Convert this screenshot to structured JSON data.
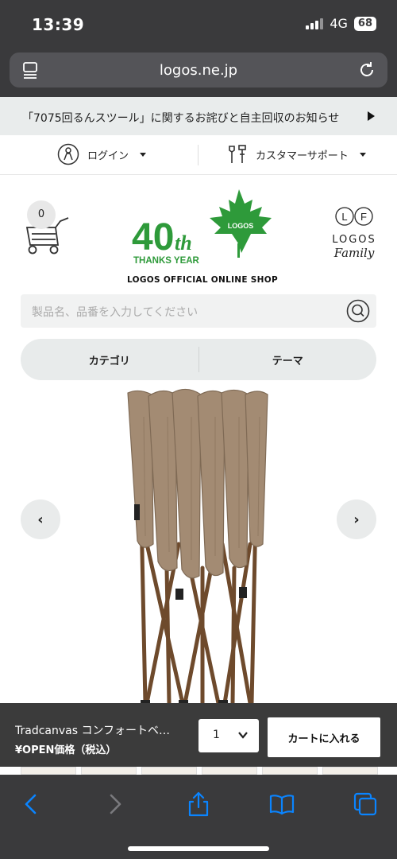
{
  "status_bar": {
    "time": "13:39",
    "network": "4G",
    "battery": "68"
  },
  "browser": {
    "url": "logos.ne.jp"
  },
  "announcement": {
    "text": "「7075回るんスツール」に関するお詫びと自主回収のお知らせ"
  },
  "utility": {
    "login_label": "ログイン",
    "support_label": "カスタマーサポート"
  },
  "header": {
    "cart_count": "0",
    "logo_40": "40",
    "logo_th": "th",
    "logo_thanks": "THANKS YEAR",
    "logo_leaf_text": "LOGOS",
    "logo_tagline": "LOGOS OFFICIAL ONLINE SHOP",
    "family_circles": [
      "L",
      "F"
    ],
    "family_top": "LOGOS",
    "family_bottom": "Family"
  },
  "search": {
    "placeholder": "製品名、品番を入力してください"
  },
  "nav": {
    "category_label": "カテゴリ",
    "theme_label": "テーマ"
  },
  "carousel": {
    "prev_label": "‹",
    "next_label": "›"
  },
  "purchase_bar": {
    "product_name": "Tradcanvas コンフォートベ…",
    "price_label": "¥OPEN価格（税込）",
    "quantity": "1",
    "add_to_cart_label": "カートに入れる"
  },
  "colors": {
    "brand_green": "#2e9a3a",
    "chrome_dark": "#3a3a3c",
    "toolbar_blue": "#0a84ff",
    "canvas_tan": "#a38b73",
    "frame_brown": "#6e4a2c"
  },
  "icons": [
    "tabs-icon",
    "reload-icon",
    "user-icon",
    "tools-icon",
    "cart-icon",
    "maple-leaf-icon",
    "search-icon",
    "back-icon",
    "forward-icon",
    "share-icon",
    "bookmarks-icon",
    "tabs-overview-icon"
  ]
}
